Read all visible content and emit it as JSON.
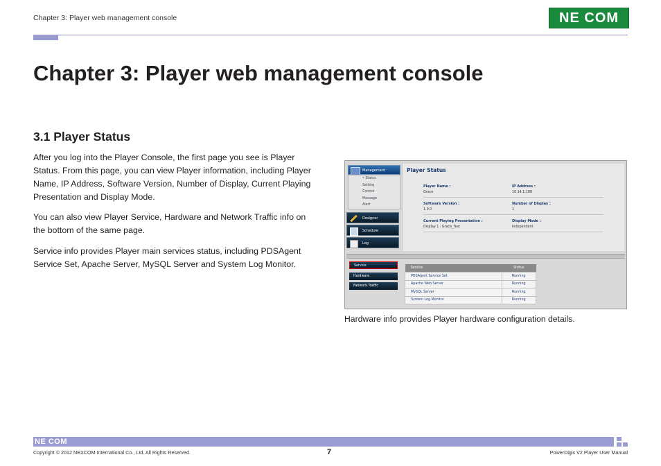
{
  "header": {
    "running_title": "Chapter 3: Player web management console",
    "logo_text": "NE COM"
  },
  "chapter_title": "Chapter 3: Player web management console",
  "section_title": "3.1 Player Status",
  "paragraphs": [
    "After you log into the Player Console, the first page you see is Player Status. From this page, you can view Player information, including Player Name, IP Address, Software Version, Number of Display, Current Playing Presentation and Display Mode.",
    "You can also view Player Service, Hardware and Network Traffic info on the bottom of the same page.",
    "Service info provides Player main services status, including PDSAgent Service Set, Apache Server, MySQL Server and System Log Monitor."
  ],
  "screenshot": {
    "nav": {
      "management": "Management",
      "sub_items": [
        "• Status",
        "Setting",
        "Control",
        "Message",
        "Alert"
      ],
      "designer": "Designer",
      "schedule": "Schedule",
      "log": "Log"
    },
    "status_title": "Player Status",
    "fields": {
      "player_name_label": "Player Name :",
      "player_name_value": "Grace",
      "ip_label": "IP Address :",
      "ip_value": "10.14.1.188",
      "software_label": "Software Version :",
      "software_value": "1.0.0",
      "displays_label": "Number of Display :",
      "displays_value": "1",
      "presentation_label": "Current Playing Presentation :",
      "presentation_value": "Display 1 : Grace_Test",
      "mode_label": "Display Mode :",
      "mode_value": "Independent"
    },
    "tabs": [
      "Service",
      "Hardware",
      "Network Traffic"
    ],
    "table": {
      "headers": [
        "Service",
        "Status"
      ],
      "rows": [
        [
          "PDSAgent Service Set",
          "Running"
        ],
        [
          "Apache Web Server",
          "Running"
        ],
        [
          "MySQL Server",
          "Running"
        ],
        [
          "System Log Monitor",
          "Running"
        ]
      ]
    }
  },
  "caption": "Hardware info provides Player hardware configuration details.",
  "footer": {
    "logo_text": "NE COM",
    "copyright": "Copyright © 2012 NEXCOM International Co., Ltd. All Rights Reserved.",
    "page_number": "7",
    "manual_name": "PowerDigis V2 Player User Manual"
  },
  "colors": {
    "accent": "#9a9bd0",
    "logo_green": "#1a8a3c",
    "nav_blue": "#1e3c6e",
    "tab_highlight": "#e00000"
  }
}
